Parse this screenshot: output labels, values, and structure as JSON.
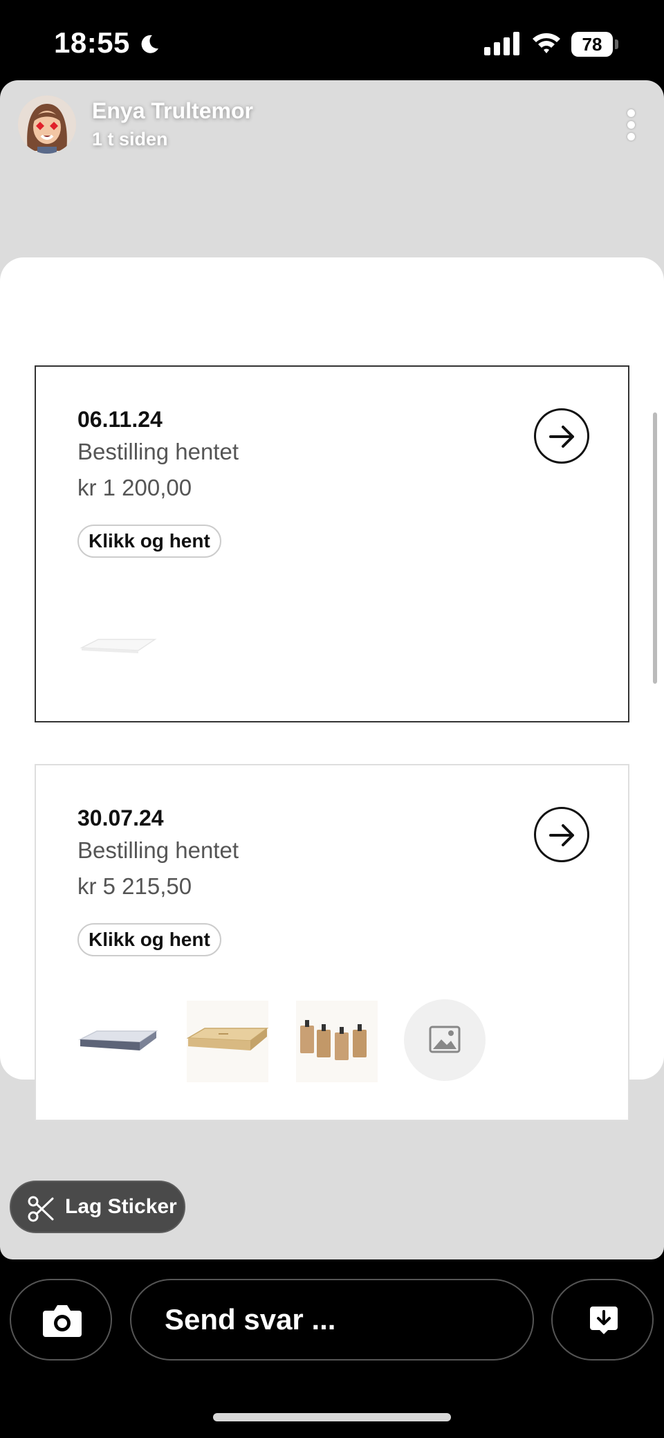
{
  "status_bar": {
    "time": "18:55",
    "battery": "78"
  },
  "story": {
    "user_name": "Enya Trultemor",
    "posted_ago": "1 t siden"
  },
  "orders": [
    {
      "date": "06.11.24",
      "status": "Bestilling hentet",
      "price": "kr 1 200,00",
      "tag": "Klikk og hent"
    },
    {
      "date": "30.07.24",
      "status": "Bestilling hentet",
      "price": "kr 5 215,50",
      "tag": "Klikk og hent"
    }
  ],
  "sticker_button": "Lag Sticker",
  "reply": {
    "placeholder": "Send svar ..."
  },
  "icons": [
    "moon-icon",
    "signal-icon",
    "wifi-icon",
    "battery-icon",
    "more-icon",
    "arrow-right-icon",
    "image-placeholder-icon",
    "scissors-icon",
    "camera-icon",
    "download-icon"
  ]
}
